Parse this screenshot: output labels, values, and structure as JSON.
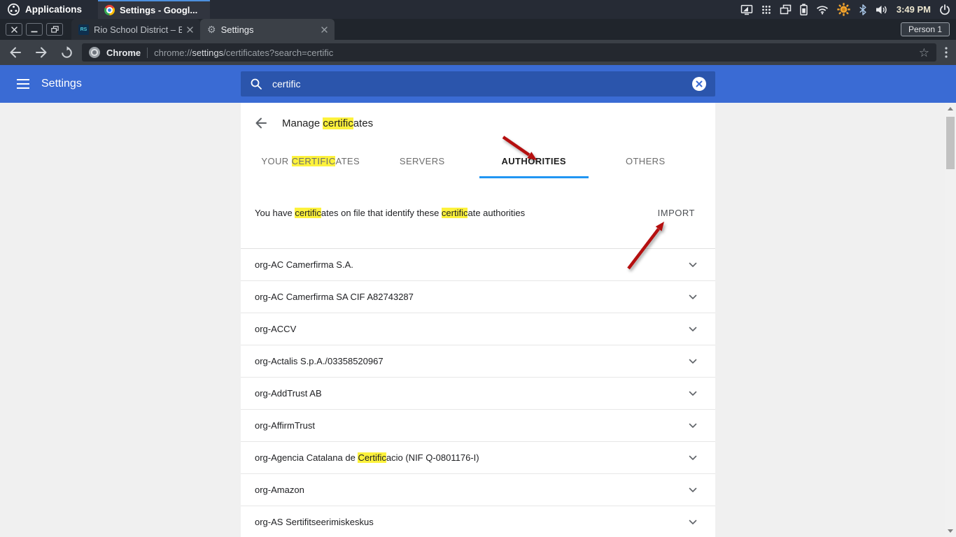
{
  "colors": {
    "header_blue": "#3a6bd4",
    "search_box_blue": "#2b55ac",
    "tab_underline_blue": "#2196f3",
    "find_highlight_yellow": "#fdf23c",
    "annotation_red": "#b50f0f"
  },
  "panel": {
    "applications_label": "Applications",
    "window_button_label": "Settings - Googl...",
    "clock": "3:49 PM",
    "tray_icon_names": [
      "display-icon",
      "app-grid-icon",
      "workspaces-icon",
      "battery-icon",
      "wifi-icon",
      "redshift-sun-icon",
      "bluetooth-icon",
      "volume-icon",
      "session-power-icon"
    ]
  },
  "tabstrip": {
    "tab_rio_label": "Rio School District – E",
    "tab_settings_label": "Settings",
    "rio_favicon_text": "RS",
    "profile_label": "Person 1"
  },
  "toolbar": {
    "origin_label": "Chrome",
    "url_scheme": "chrome://",
    "url_host": "settings",
    "url_rest": "/certificates?search=certific"
  },
  "settings_header": {
    "title": "Settings",
    "search_value": "certific"
  },
  "page": {
    "title": {
      "pre": "Manage ",
      "match": "certific",
      "post": "ates"
    },
    "tabs": {
      "your_certificates": {
        "pre": "YOUR ",
        "match": "CERTIFIC",
        "post": "ATES"
      },
      "servers": "SERVERS",
      "authorities": "AUTHORITIES",
      "others": "OTHERS"
    },
    "description": {
      "p1": "You have ",
      "m1": "certific",
      "p2": "ates on file that identify these ",
      "m2": "certific",
      "p3": "ate authorities"
    },
    "import_label": "IMPORT",
    "certificates": [
      {
        "pre": "org-AC Camerfirma S.A.",
        "match": "",
        "post": ""
      },
      {
        "pre": "org-AC Camerfirma SA CIF A82743287",
        "match": "",
        "post": ""
      },
      {
        "pre": "org-ACCV",
        "match": "",
        "post": ""
      },
      {
        "pre": "org-Actalis S.p.A./03358520967",
        "match": "",
        "post": ""
      },
      {
        "pre": "org-AddTrust AB",
        "match": "",
        "post": ""
      },
      {
        "pre": "org-AffirmTrust",
        "match": "",
        "post": ""
      },
      {
        "pre": "org-Agencia Catalana de ",
        "match": "Certific",
        "post": "acio (NIF Q-0801176-I)"
      },
      {
        "pre": "org-Amazon",
        "match": "",
        "post": ""
      },
      {
        "pre": "org-AS Sertifitseerimiskeskus",
        "match": "",
        "post": ""
      }
    ]
  }
}
